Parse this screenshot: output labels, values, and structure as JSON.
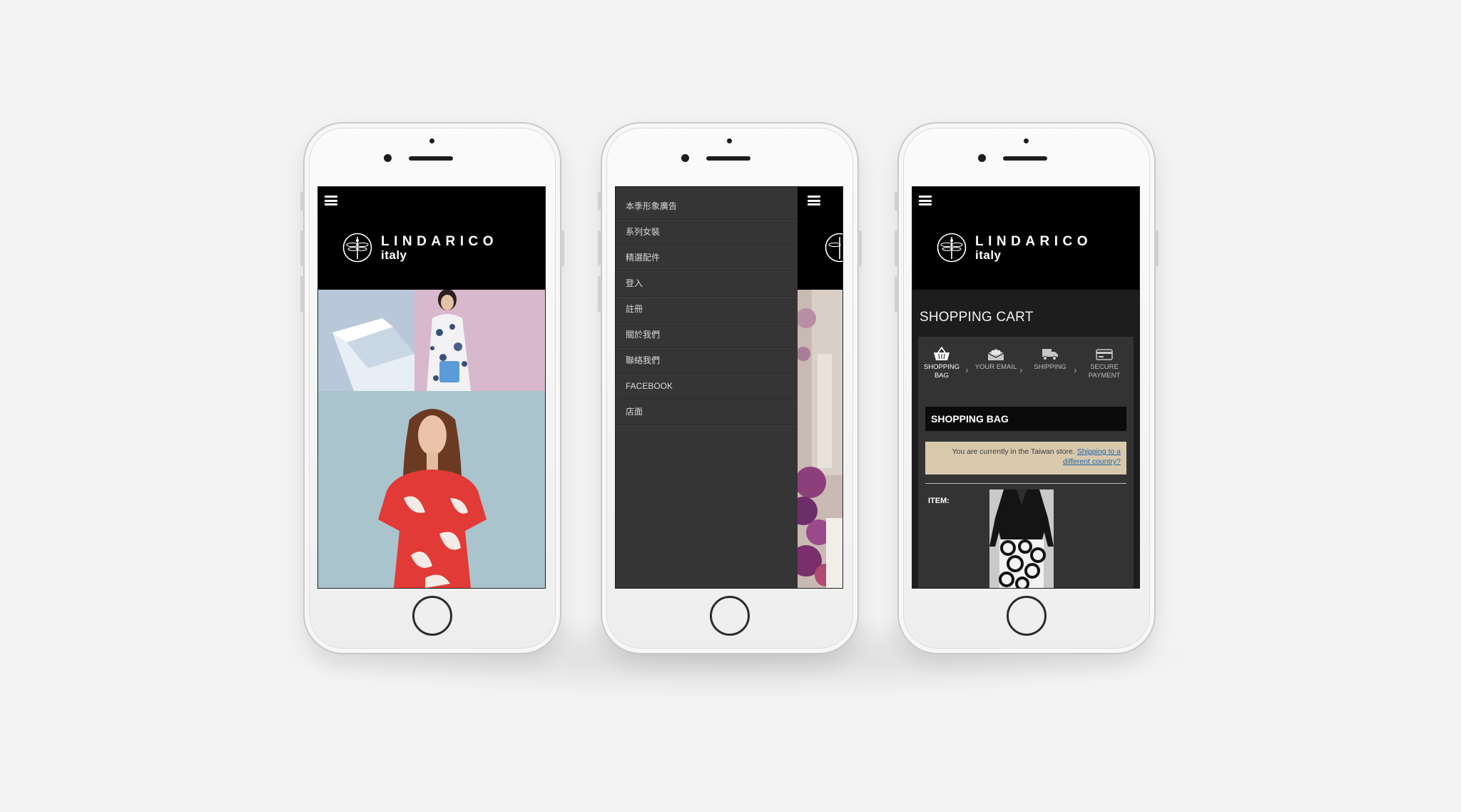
{
  "brand": {
    "name": "LINDARICO",
    "sub": "italy"
  },
  "menu": {
    "items": [
      "本季形象廣告",
      "系列女裝",
      "精選配件",
      "登入",
      "註冊",
      "關於我們",
      "聯絡我們",
      "FACEBOOK",
      "店面"
    ]
  },
  "cart": {
    "title": "SHOPPING CART",
    "steps": [
      {
        "line1": "SHOPPING",
        "line2": "BAG",
        "icon": "basket-icon"
      },
      {
        "line1": "YOUR EMAIL",
        "line2": "",
        "icon": "envelope-icon"
      },
      {
        "line1": "SHIPPING",
        "line2": "",
        "icon": "truck-icon"
      },
      {
        "line1": "SECURE",
        "line2": "PAYMENT",
        "icon": "card-icon"
      }
    ],
    "section_title": "SHOPPING BAG",
    "notice_text": "You are currently in the Taiwan store.",
    "notice_link": "Shipping to a different country?",
    "item_label": "ITEM:"
  },
  "colors": {
    "page_bg": "#f3f3f3",
    "header_bg": "#000000",
    "menu_bg": "#353535",
    "notice_bg": "#d8c9ad",
    "link": "#1f62a8"
  }
}
